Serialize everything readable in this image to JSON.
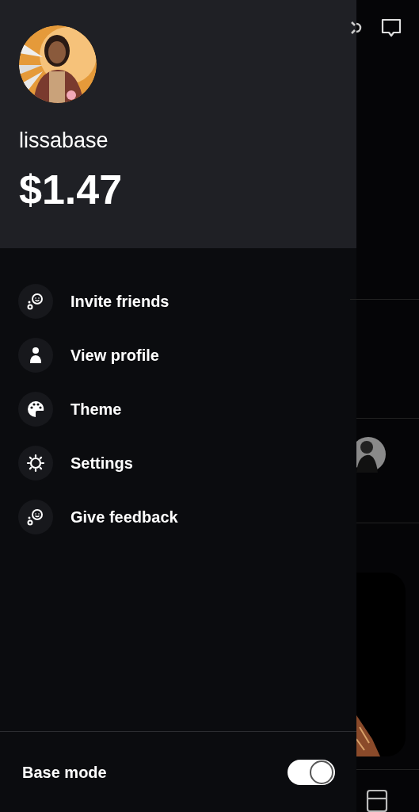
{
  "profile": {
    "username": "lissabase",
    "balance": "$1.47"
  },
  "menu": [
    {
      "kind": "invite",
      "label": "Invite friends"
    },
    {
      "kind": "profile",
      "label": "View profile"
    },
    {
      "kind": "theme",
      "label": "Theme"
    },
    {
      "kind": "settings",
      "label": "Settings"
    },
    {
      "kind": "feedback",
      "label": "Give feedback"
    }
  ],
  "base_mode": {
    "label": "Base mode",
    "on": true
  }
}
